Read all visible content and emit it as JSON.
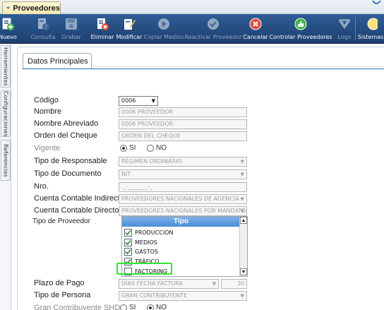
{
  "window": {
    "tab_title": "Proveedores"
  },
  "toolbar": {
    "buttons": [
      {
        "label": "Nuevo",
        "icon": "new-doc-icon",
        "enabled": true
      },
      {
        "label": "Consulta",
        "icon": "query-doc-icon",
        "enabled": false
      },
      {
        "label": "Grabar",
        "icon": "save-icon",
        "enabled": false
      },
      {
        "label": "Eliminar",
        "icon": "delete-doc-icon",
        "enabled": true
      },
      {
        "label": "Modificar",
        "icon": "edit-icon",
        "enabled": true
      },
      {
        "label": "Copiar Medios",
        "icon": "play-circle-icon",
        "enabled": false
      },
      {
        "label": "Reactivar Proveedor",
        "icon": "check-circle-icon",
        "enabled": false
      },
      {
        "label": "Cancelar",
        "icon": "cancel-icon",
        "enabled": true
      },
      {
        "label": "Controlar Proveedores",
        "icon": "thumbs-up-icon",
        "enabled": true
      },
      {
        "label": "Logo",
        "icon": "logo-icon",
        "enabled": false
      },
      {
        "label": "Sistemas",
        "icon": "systems-icon",
        "enabled": true
      }
    ]
  },
  "left_tabs": [
    "Herramientas",
    "Configuraciones",
    "Referencias"
  ],
  "section_tab": "Datos Principales",
  "form": {
    "codigo": {
      "label": "Código",
      "value": "0006"
    },
    "nombre": {
      "label": "Nombre",
      "value": "0006 PROVEEDOR"
    },
    "nombre_abreviado": {
      "label": "Nombre Abreviado",
      "value": "0006 PROVEEDOR"
    },
    "orden_cheque": {
      "label": "Orden del Cheque",
      "value": "ORDEN DEL CHEQUE"
    },
    "vigente": {
      "label": "Vigente",
      "option_si": "SI",
      "option_no": "NO",
      "selected": "SI"
    },
    "tipo_responsable": {
      "label": "Tipo de Responsable",
      "value": "RÉGIMEN ORDINARIO"
    },
    "tipo_documento": {
      "label": "Tipo de Documento",
      "value": "NIT"
    },
    "nro": {
      "label": "Nro.",
      "value": "._-_______-_"
    },
    "cuenta_indirecto": {
      "label": "Cuenta Contable Indirecto",
      "value": "PROVEEDORES NACIONALES DE AGENCIA"
    },
    "cuenta_directo": {
      "label": "Cuenta Contable Directo",
      "value": "PROVEEDORES NACIONALES POR MANDATO"
    },
    "tipo_proveedor": {
      "label": "Tipo de Proveedor",
      "column_header": "Tipo",
      "items": [
        {
          "label": "PRODUCCIÓN",
          "checked": true
        },
        {
          "label": "MEDIOS",
          "checked": true
        },
        {
          "label": "GASTOS",
          "checked": true
        },
        {
          "label": "TRÁFICO",
          "checked": true
        },
        {
          "label": "FACTORING",
          "checked": false
        }
      ]
    },
    "plazo_pago": {
      "label": "Plazo de Pago",
      "value": "DÍAS FECHA FACTURA",
      "days": "30"
    },
    "tipo_persona": {
      "label": "Tipo de Persona",
      "value": "GRAN CONTRIBUYENTE"
    },
    "gran_contribuyente": {
      "label": "Gran Contribuyente SHD",
      "option_si": "SI",
      "option_no": "NO",
      "selected": "NO"
    }
  },
  "colors": {
    "toolbar": "#2a5288",
    "list_header": "#5b97de",
    "highlight": "#2ee82e"
  }
}
